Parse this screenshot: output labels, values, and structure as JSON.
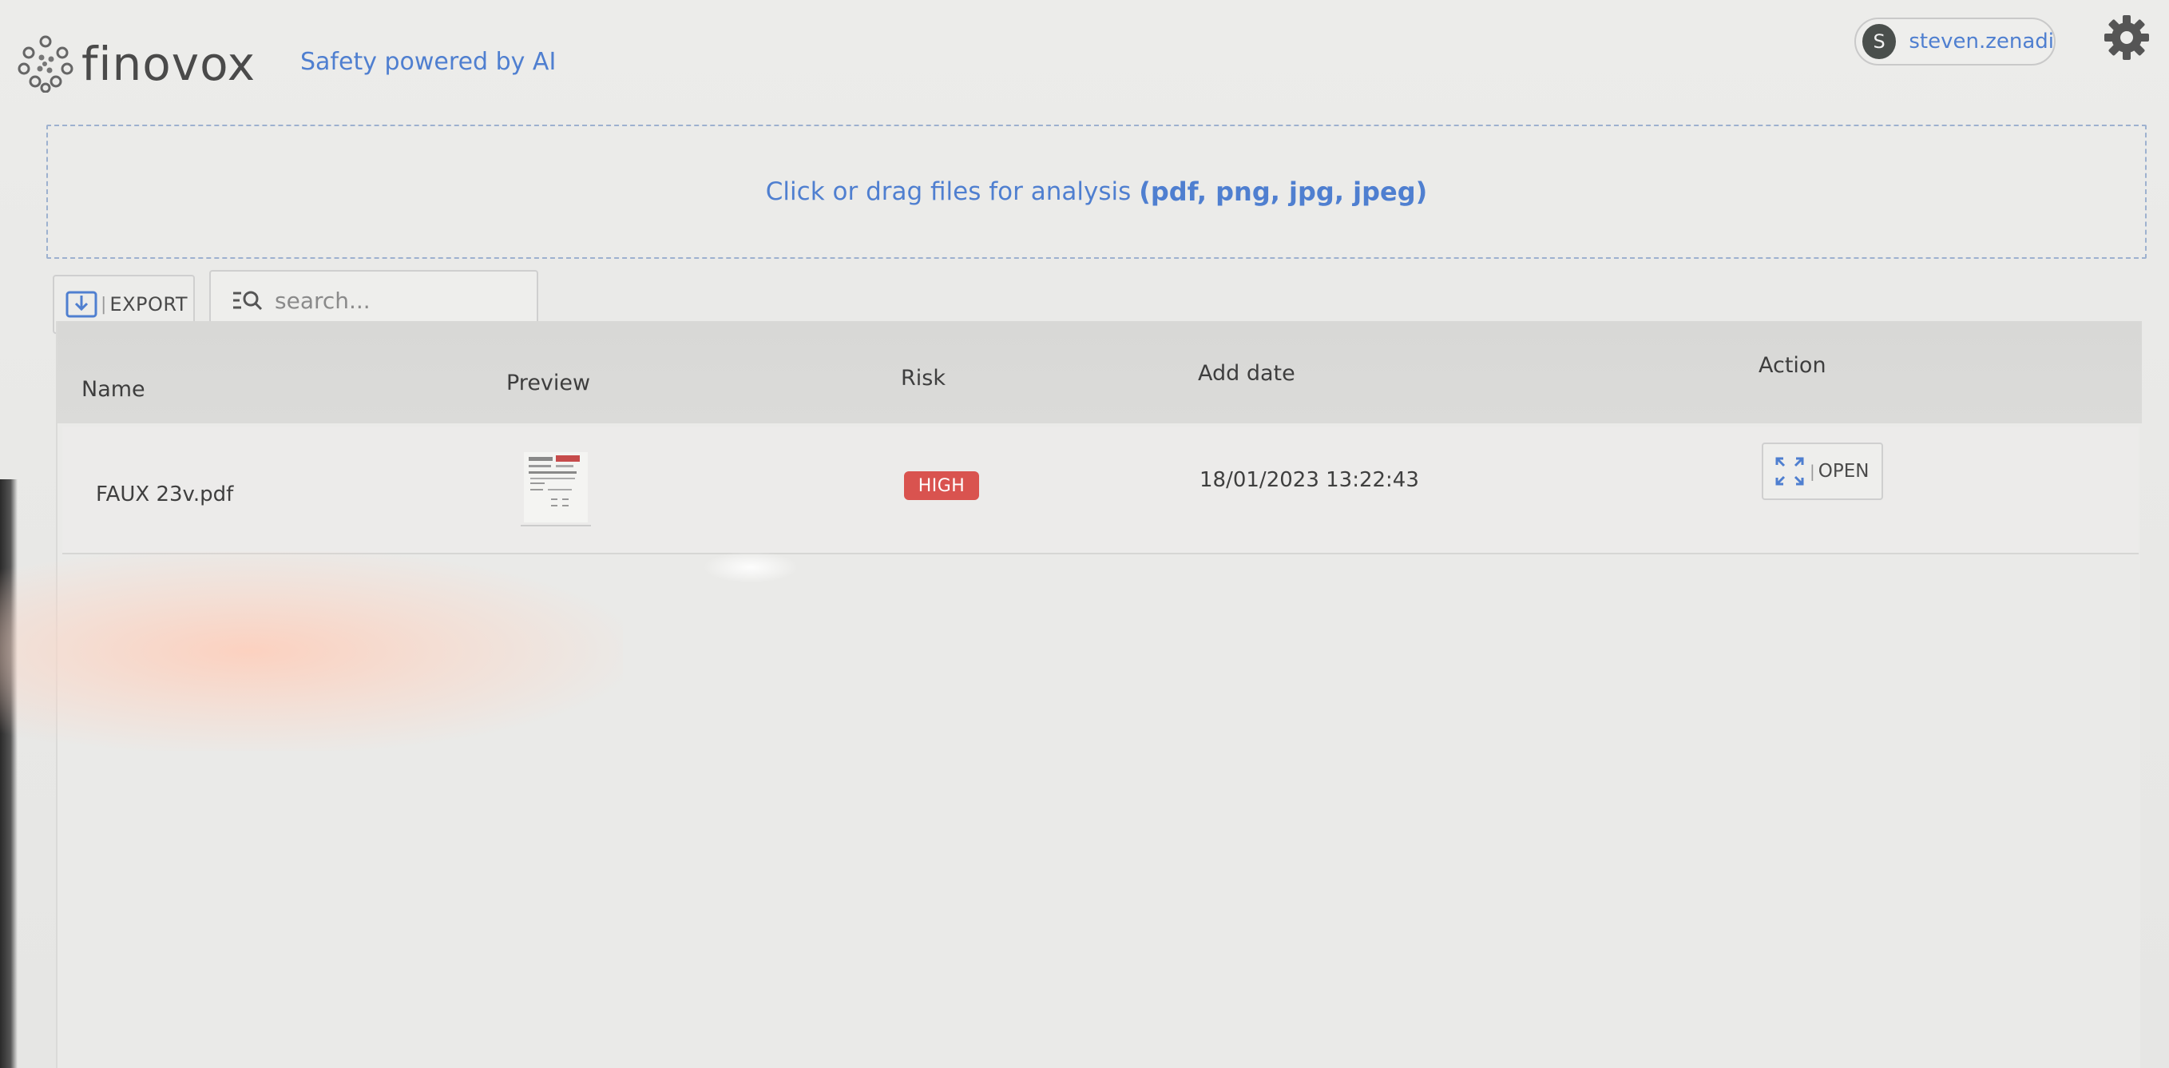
{
  "header": {
    "brand_name": "finovox",
    "tagline": "Safety powered by AI",
    "user": {
      "avatar_initial": "S",
      "username": "steven.zenadi"
    },
    "settings_icon": "gear-icon"
  },
  "dropzone": {
    "text": "Click or drag files for analysis",
    "file_types": "(pdf, png, jpg, jpeg)"
  },
  "toolbar": {
    "export_label": "EXPORT",
    "export_separator": "|",
    "search_placeholder": "search..."
  },
  "table": {
    "columns": [
      "Name",
      "Preview",
      "Risk",
      "Add date",
      "Action"
    ],
    "rows": [
      {
        "name": "FAUX 23v.pdf",
        "risk": "HIGH",
        "add_date": "18/01/2023 13:22:43",
        "action_label": "OPEN",
        "action_separator": "|"
      }
    ]
  },
  "colors": {
    "accent_blue": "#4f7fd0",
    "risk_high": "#d9534f",
    "header_bg": "#d8d8d6"
  }
}
